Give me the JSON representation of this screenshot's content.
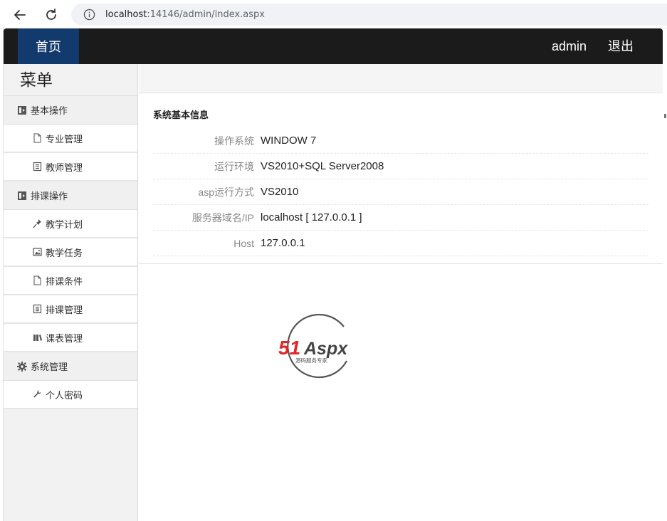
{
  "browser": {
    "url_host": "localhost",
    "url_rest": ":14146/admin/index.aspx"
  },
  "topbar": {
    "home": "首页",
    "user": "admin",
    "logout": "退出"
  },
  "sidebar": {
    "title": "菜单",
    "groups": [
      {
        "label": "基本操作",
        "items": [
          "专业管理",
          "教师管理"
        ]
      },
      {
        "label": "排课操作",
        "items": [
          "教学计划",
          "教学任务",
          "排课条件",
          "排课管理",
          "课表管理"
        ]
      },
      {
        "label": "系统管理",
        "items": [
          "个人密码"
        ]
      }
    ]
  },
  "main": {
    "panel_title": "系统基本信息",
    "rows": [
      {
        "label": "操作系统",
        "value": "WINDOW 7"
      },
      {
        "label": "运行环境",
        "value": "VS2010+SQL Server2008"
      },
      {
        "label": "asp运行方式",
        "value": "VS2010"
      },
      {
        "label": "服务器域名/IP",
        "value": "localhost [ 127.0.0.1 ]"
      },
      {
        "label": "Host",
        "value": "127.0.0.1"
      }
    ]
  },
  "logo": {
    "text_51": "51",
    "text_aspx": "Aspx",
    "subtitle": "源码服务专家",
    "colors": {
      "red": "#e0262b",
      "dark": "#444444",
      "green": "#3aa940"
    }
  }
}
